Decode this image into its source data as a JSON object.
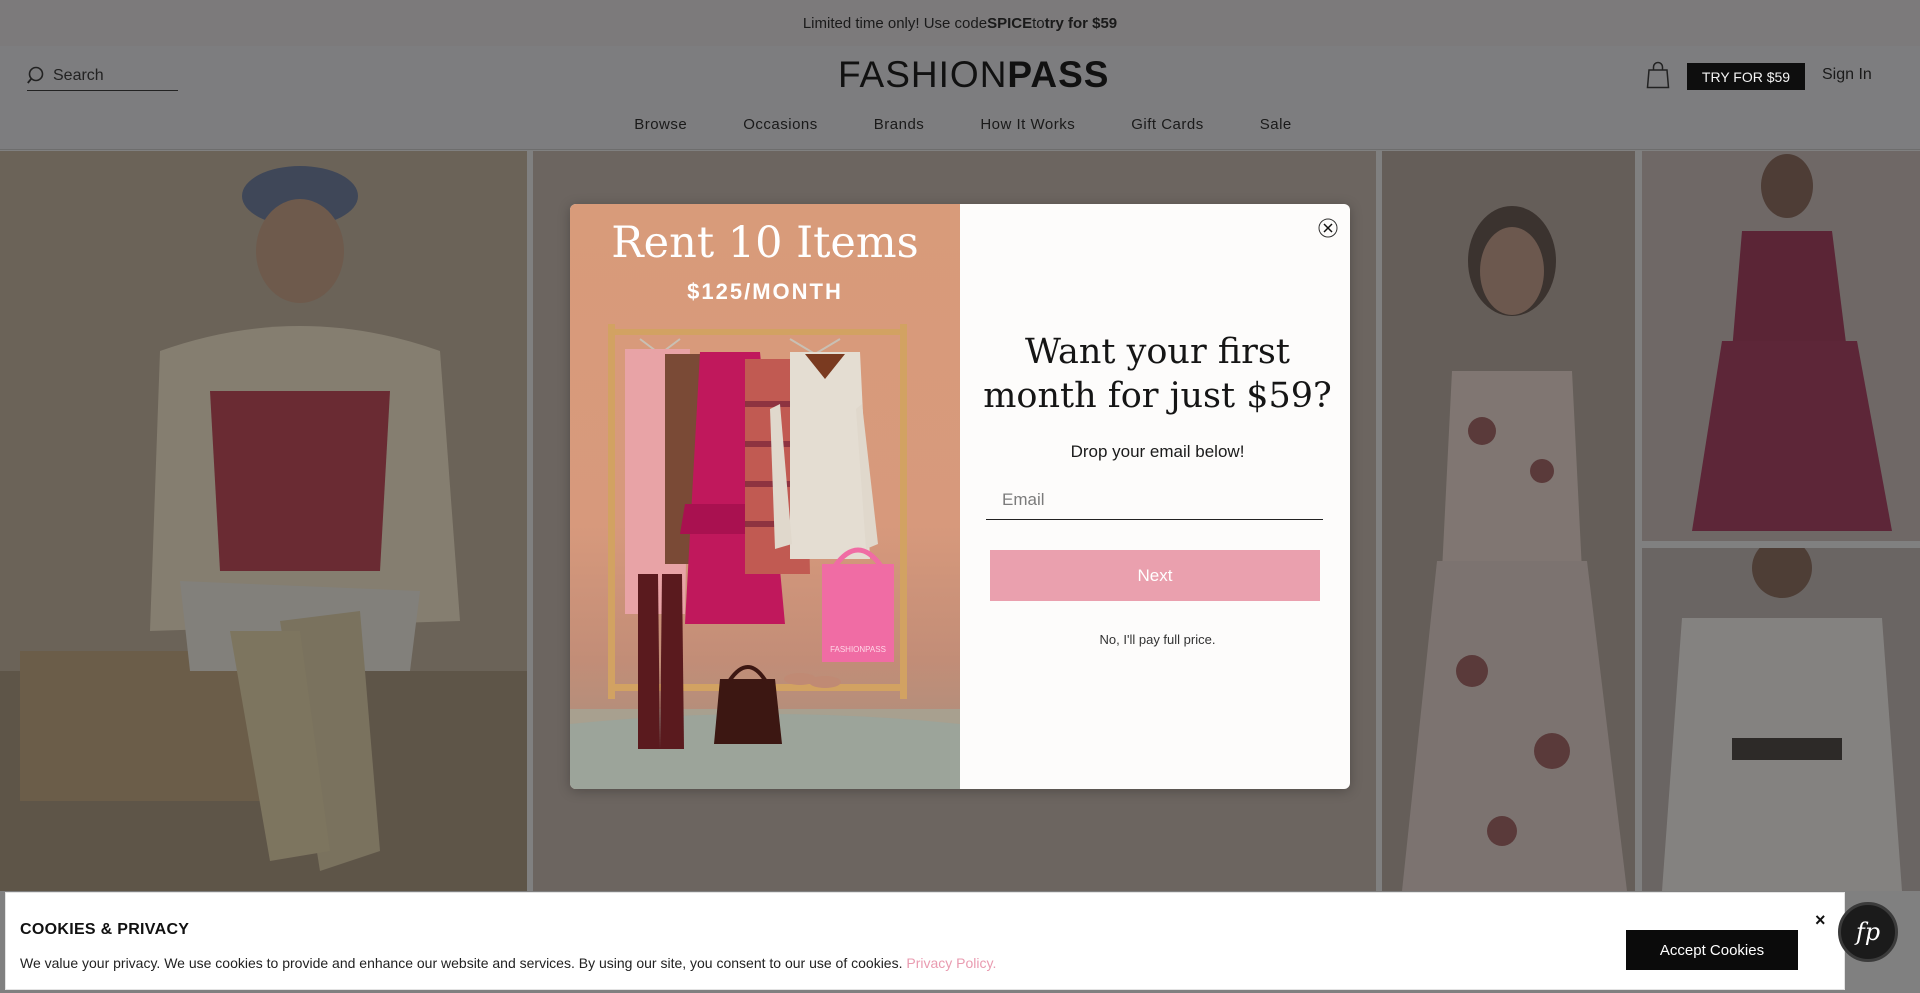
{
  "announcement": {
    "prefix": "Limited time only! Use code ",
    "code": "SPICE",
    "middle": " to ",
    "offer": "try for $59"
  },
  "header": {
    "search_label": "Search",
    "logo_light": "FASHION",
    "logo_bold": "PASS",
    "try_button": "TRY FOR $59",
    "sign_in": "Sign In"
  },
  "nav": {
    "items": [
      "Browse",
      "Occasions",
      "Brands",
      "How It Works",
      "Gift Cards",
      "Sale"
    ]
  },
  "modal": {
    "promo_title": "Rent 10 Items",
    "promo_sub": "$125/MONTH",
    "headline": "Want your first month for just $59?",
    "prompt": "Drop your email below!",
    "email_placeholder": "Email",
    "next_button": "Next",
    "decline": "No, I'll pay full price.",
    "bag_label": "FASHIONPASS"
  },
  "cookies": {
    "title": "COOKIES & PRIVACY",
    "text": "We value your privacy. We use cookies to provide and enhance our website and services. By using our site, you consent to our use of cookies. ",
    "link": "Privacy Policy.",
    "accept_button": "Accept Cookies",
    "close": "×"
  },
  "chat_badge": {
    "label": "fp"
  },
  "colors": {
    "accent_pink": "#eaa0ae",
    "overlay": "#808080",
    "button_dark": "#0e0e0e"
  }
}
